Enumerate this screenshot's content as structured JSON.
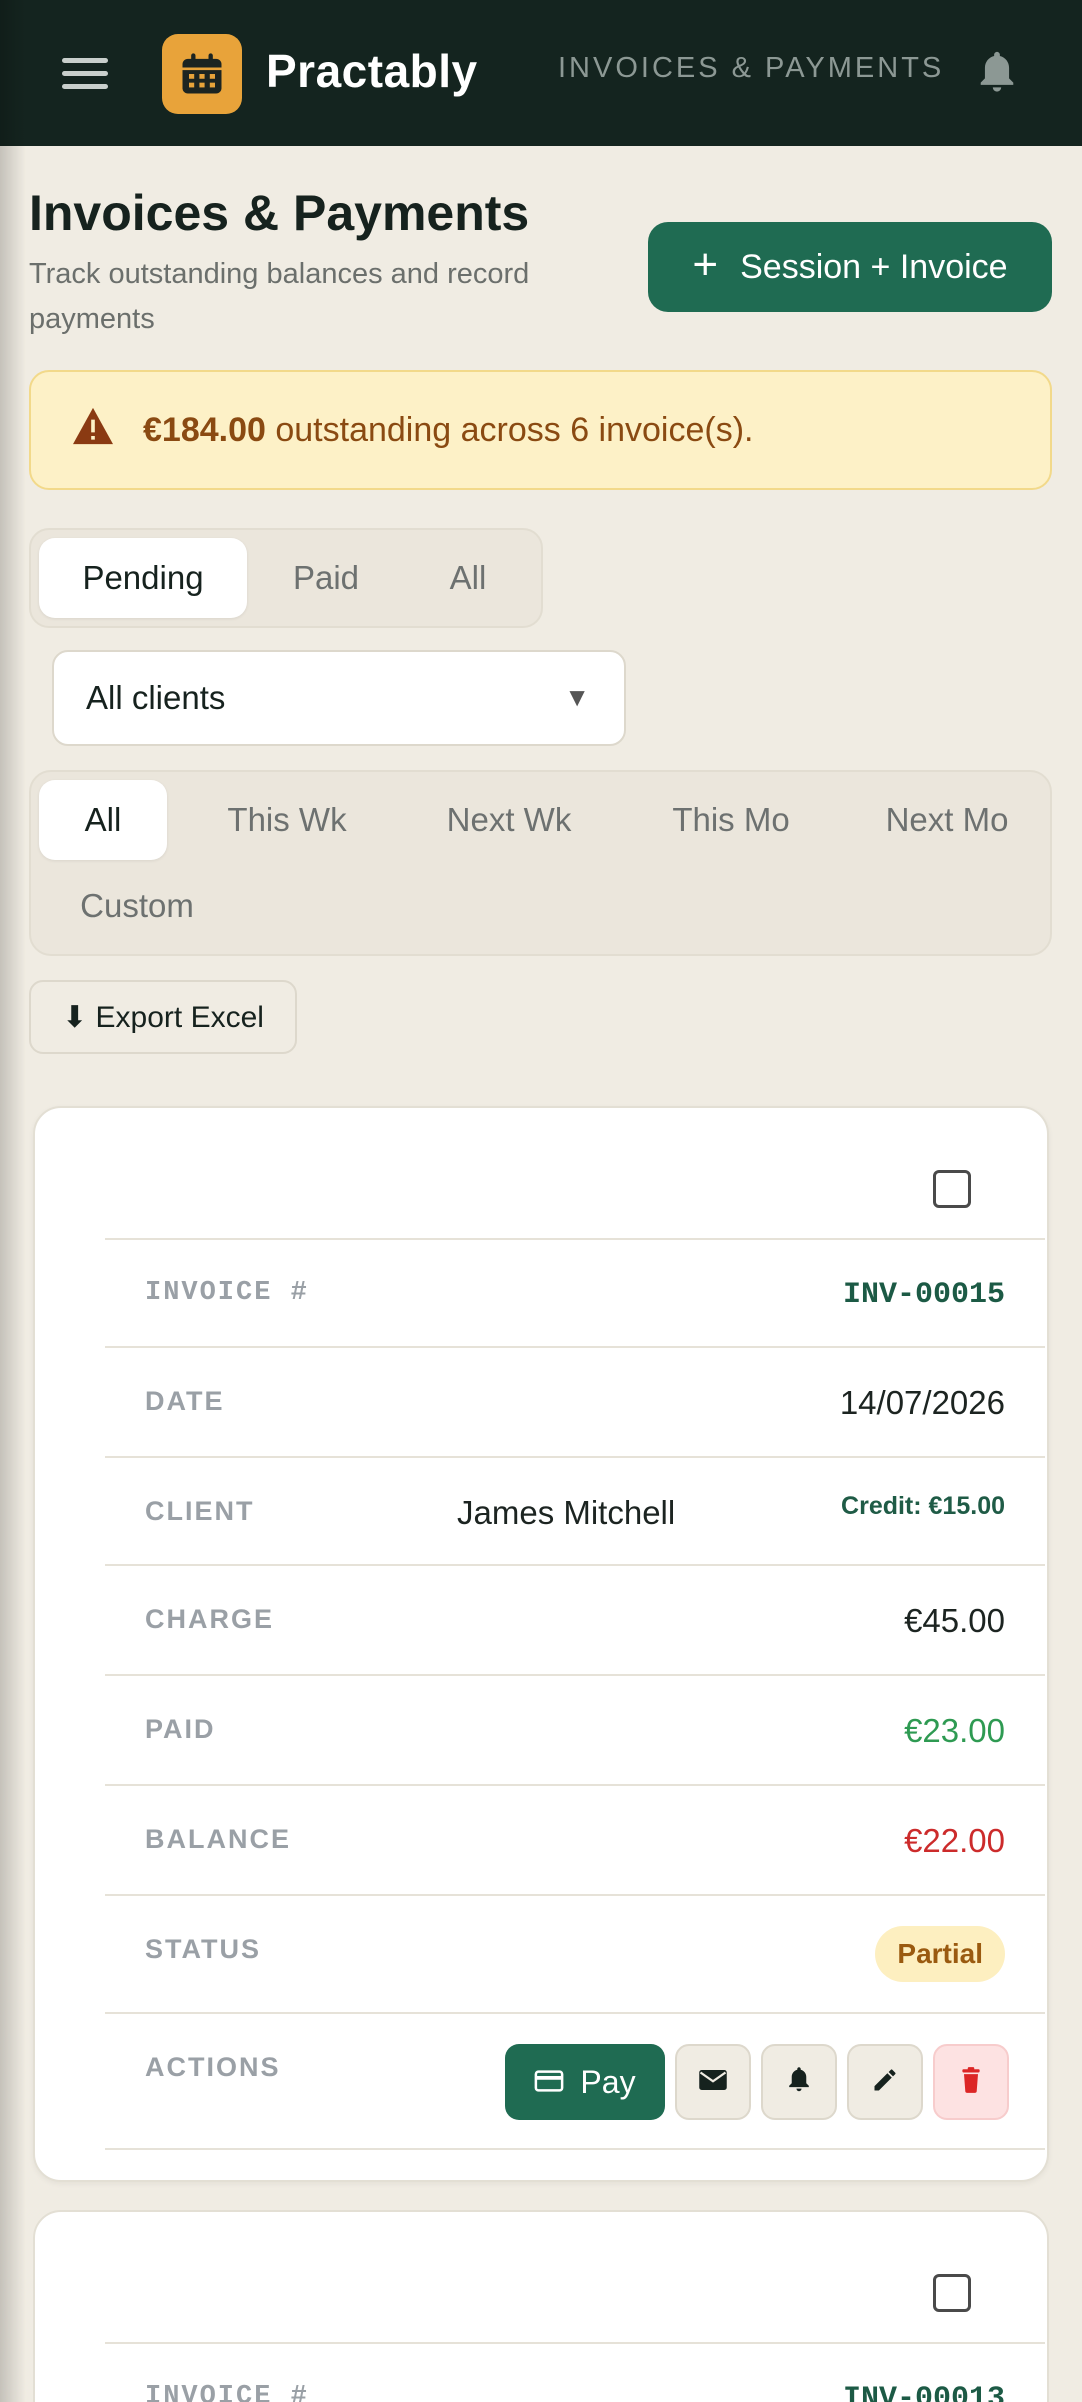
{
  "app": {
    "brand": "Practably",
    "nav_label": "INVOICES & PAYMENTS"
  },
  "header": {
    "title": "Invoices & Payments",
    "subtitle": "Track outstanding balances and record payments",
    "primary_button": "Session + Invoice"
  },
  "alert": {
    "amount": "€184.00",
    "message": "outstanding across 6 invoice(s)."
  },
  "status_tabs": [
    {
      "label": "Pending",
      "active": true
    },
    {
      "label": "Paid",
      "active": false
    },
    {
      "label": "All",
      "active": false
    }
  ],
  "client_filter": {
    "selected": "All clients"
  },
  "date_filters": [
    {
      "label": "All",
      "active": true
    },
    {
      "label": "This Wk",
      "active": false
    },
    {
      "label": "Next Wk",
      "active": false
    },
    {
      "label": "This Mo",
      "active": false
    },
    {
      "label": "Next Mo",
      "active": false
    },
    {
      "label": "Custom",
      "active": false
    }
  ],
  "export_button": "⬇ Export Excel",
  "invoices": [
    {
      "labels": {
        "invoice_no": "INVOICE #",
        "date": "DATE",
        "client": "CLIENT",
        "charge": "CHARGE",
        "paid": "PAID",
        "balance": "BALANCE",
        "status": "STATUS",
        "actions": "ACTIONS"
      },
      "invoice_no": "INV-00015",
      "date": "14/07/2026",
      "client": "James Mitchell",
      "credit": "Credit: €15.00",
      "charge": "€45.00",
      "paid": "€23.00",
      "balance": "€22.00",
      "status": "Partial",
      "pay_label": "Pay"
    },
    {
      "labels": {
        "invoice_no": "INVOICE #"
      },
      "invoice_no": "INV-00013"
    }
  ],
  "colors": {
    "topbar": "#14241f",
    "primary": "#1f6b52",
    "accent_logo": "#e8a33a",
    "paid": "#2e9a52",
    "balance": "#cc2b2b",
    "alert_bg": "#fdf1c7"
  }
}
